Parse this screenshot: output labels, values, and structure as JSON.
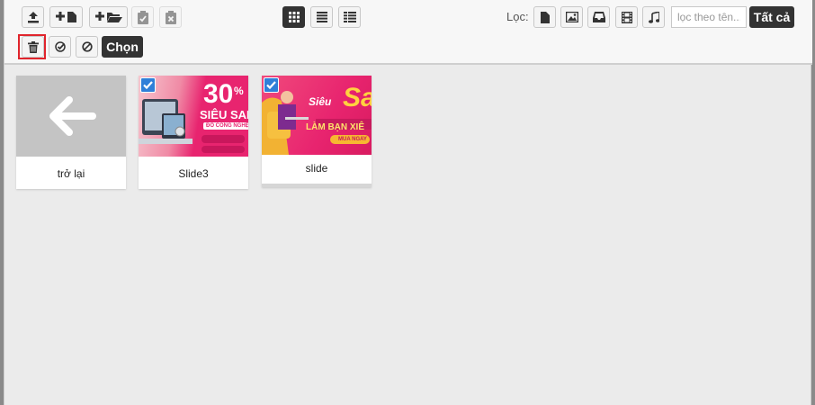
{
  "toolbar": {
    "filter_label": "Lọc:",
    "search_placeholder": "lọc theo tên...",
    "all_label": "Tất cả",
    "choose_label": "Chọn"
  },
  "icons": {
    "upload": "upload-icon",
    "new_file": "add-file-icon",
    "new_folder": "add-folder-icon",
    "paste": "paste-icon",
    "clear_clipboard": "clear-clipboard-icon",
    "view_grid": "grid-view-icon",
    "view_list": "list-view-icon",
    "view_columns": "columns-view-icon",
    "filter_file": "file-icon",
    "filter_image": "image-icon",
    "filter_archive": "archive-icon",
    "filter_video": "video-icon",
    "filter_audio": "music-icon",
    "delete": "trash-icon",
    "select_all": "check-circle-icon",
    "deselect": "ban-icon",
    "back_arrow": "arrow-left-icon",
    "checkbox": "checkbox-checked-icon"
  },
  "colors": {
    "accent_dark": "#333333",
    "highlight_red": "#e0242c",
    "check_blue": "#2f7fd8",
    "promo_pink": "#e8246f"
  },
  "files": [
    {
      "name": "trở lại",
      "type": "back"
    },
    {
      "name": "Slide3",
      "type": "image",
      "selected": true,
      "promo": {
        "big": "30",
        "pct": "%",
        "line1": "SIÊU SAL",
        "line2": "ĐỒ CÔNG NGHỆ"
      }
    },
    {
      "name": "slide",
      "type": "image",
      "selected": true,
      "promo": {
        "line1": "Siêu",
        "line2": "Sa",
        "line3": "LÀM BẠN XIÊ",
        "line4": "MUA NGAY"
      }
    }
  ]
}
